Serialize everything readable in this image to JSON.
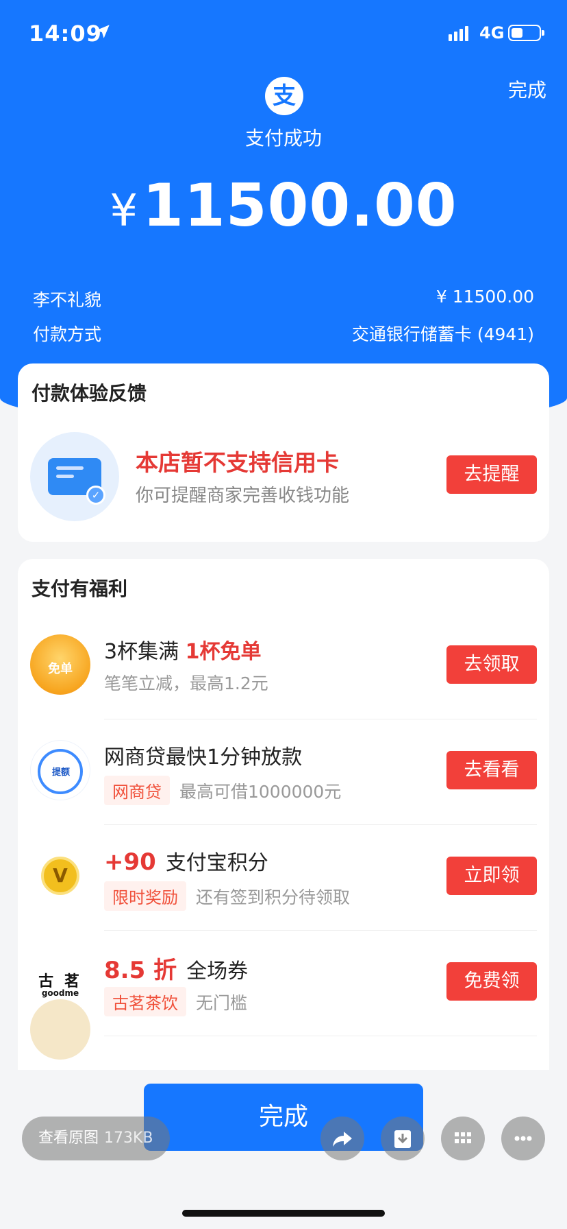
{
  "status_bar": {
    "time": "14:09",
    "network": "4G"
  },
  "header": {
    "done_label": "完成",
    "logo_char": "支",
    "status_text": "支付成功",
    "amount_currency": "¥",
    "amount_value": "11500.00"
  },
  "details": {
    "payee_label": "李不礼貌",
    "payee_amount": "¥ 11500.00",
    "method_label": "付款方式",
    "method_value": "交通银行储蓄卡 (4941)"
  },
  "feedback_card": {
    "title": "付款体验反馈",
    "main_text": "本店暂不支持信用卡",
    "sub_text": "你可提醒商家完善收钱功能",
    "button_label": "去提醒"
  },
  "benefits_card": {
    "title": "支付有福利",
    "items": [
      {
        "title_pre": "3杯集满 ",
        "title_hl": "1杯免单",
        "sub": "笔笔立减，最高1.2元",
        "button": "去领取",
        "icon_text": "免单"
      },
      {
        "title": "网商贷最快1分钟放款",
        "tag": "网商贷",
        "sub": "最高可借1000000元",
        "button": "去看看",
        "icon_text": "提额"
      },
      {
        "title_big": "+90",
        "title": "支付宝积分",
        "tag": "限时奖励",
        "sub": "还有签到积分待领取",
        "button": "立即领",
        "icon_text": "V"
      },
      {
        "title_big": "8.5 折",
        "title": "全场券",
        "tag": "古茗茶饮",
        "sub": "无门槛",
        "button": "免费领",
        "icon_text_1": "古 茗",
        "icon_text_2": "goodme"
      }
    ]
  },
  "bottom": {
    "done_label": "完成",
    "view_original": "查看原图",
    "view_original_size": "173KB"
  }
}
